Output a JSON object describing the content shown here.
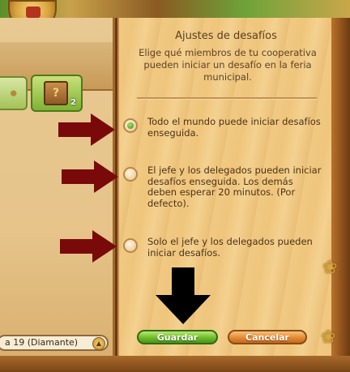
{
  "left_panel": {
    "slot_count": "2",
    "league_value": "a 19 (Diamante)"
  },
  "dialog": {
    "title": "Ajustes de desafíos",
    "description": "Elige qué miembros de tu cooperativa pueden iniciar un desafío en la feria municipal.",
    "options": [
      {
        "label": "Todo el mundo puede iniciar desafíos enseguida.",
        "selected": true
      },
      {
        "label": "El jefe y los delegados pueden iniciar desafíos enseguida. Los demás deben esperar 20 minutos. (Por defecto).",
        "selected": false
      },
      {
        "label": "Solo el jefe y los delegados pueden iniciar desafíos.",
        "selected": false
      }
    ],
    "save_label": "Guardar",
    "cancel_label": "Cancelar"
  },
  "colors": {
    "save_green": "#6fbb2a",
    "cancel_orange": "#e48a35",
    "annotation_red": "#7a0a0a",
    "annotation_black": "#000000"
  }
}
